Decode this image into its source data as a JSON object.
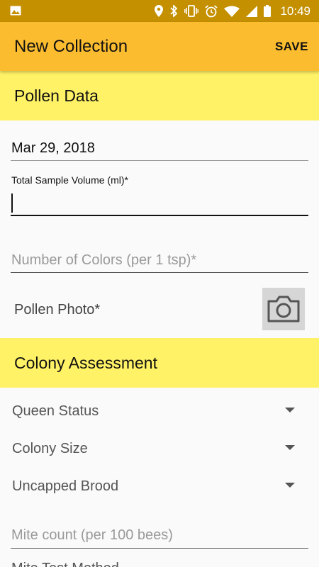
{
  "status_bar": {
    "time": "10:49",
    "icons": [
      "image-icon",
      "location-icon",
      "bluetooth-icon",
      "vibrate-icon",
      "alarm-icon",
      "wifi-icon",
      "signal-icon",
      "battery-icon"
    ]
  },
  "app_bar": {
    "title": "New Collection",
    "save_label": "SAVE"
  },
  "colors": {
    "status_bar": "#c49000",
    "app_bar": "#fbbd2f",
    "section_header": "#fff266"
  },
  "pollen_section": {
    "title": "Pollen Data",
    "date_value": "Mar 29, 2018",
    "sample_volume_label": "Total Sample Volume (ml)*",
    "sample_volume_value": "",
    "colors_placeholder": "Number of Colors (per 1 tsp)*",
    "photo_label": "Pollen Photo*",
    "photo_button_icon": "camera-icon"
  },
  "colony_section": {
    "title": "Colony Assessment",
    "dropdowns": [
      {
        "label": "Queen Status"
      },
      {
        "label": "Colony Size"
      },
      {
        "label": "Uncapped Brood"
      }
    ],
    "mite_count_placeholder": "Mite count (per 100 bees)",
    "partial_label": "Mite Test Method"
  }
}
